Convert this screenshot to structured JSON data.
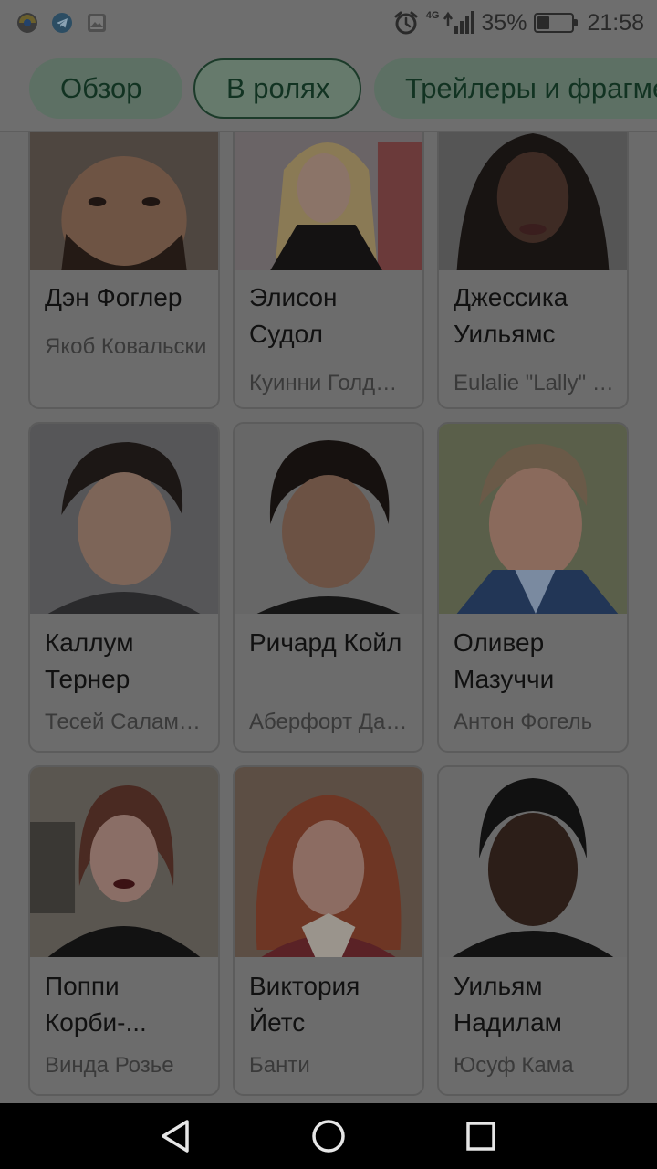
{
  "status_bar": {
    "network": "4G",
    "battery": "35%",
    "battery_level": 0.35,
    "time": "21:58"
  },
  "tabs": [
    {
      "label": "Обзор",
      "selected": false
    },
    {
      "label": "В ролях",
      "selected": true
    },
    {
      "label": "Трейлеры и фрагменты",
      "selected": false
    }
  ],
  "cast": [
    {
      "name": "Дэн Фоглер",
      "role": "Якоб Ковальски"
    },
    {
      "name": "Элисон Судол",
      "role": "Куинни Голдштейн"
    },
    {
      "name": "Джессика Уильямс",
      "role": "Eulalie \"Lally\" Hicks"
    },
    {
      "name": "Каллум Тернер",
      "role": "Тесей Саламандер"
    },
    {
      "name": "Ричард Койл",
      "role": "Аберфорт Дамблдор"
    },
    {
      "name": "Оливер Мазуччи",
      "role": "Антон Фогель"
    },
    {
      "name": "Поппи Корби-...",
      "role": "Винда Розье"
    },
    {
      "name": "Виктория Йетс",
      "role": "Банти"
    },
    {
      "name": "Уильям Надилам",
      "role": "Юсуф Кама"
    }
  ],
  "icons": {
    "status_left": [
      "app-badge-icon",
      "telegram-icon",
      "gallery-icon"
    ],
    "status_right": [
      "alarm-icon",
      "signal-icon",
      "battery-icon"
    ],
    "nav": [
      "back-icon",
      "home-icon",
      "recents-icon"
    ]
  },
  "colors": {
    "dim_overlay": "#6b6b6b",
    "tab_fill": "#5d7064",
    "tab_text": "#123322",
    "nav_bg": "#000000"
  }
}
